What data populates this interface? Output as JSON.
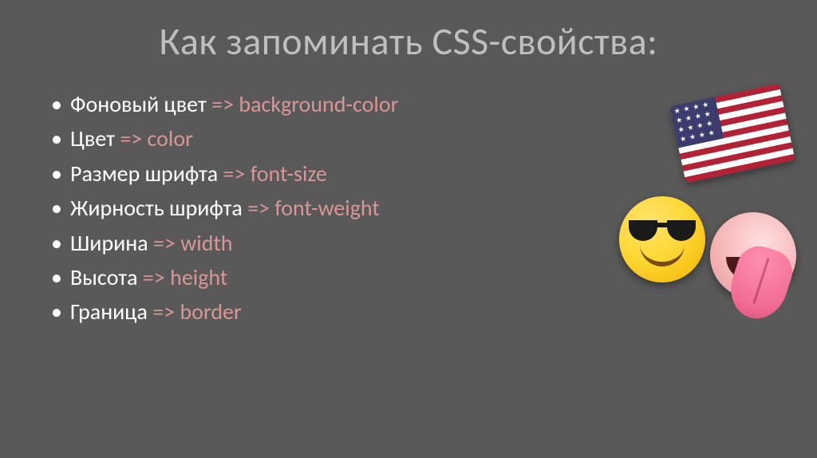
{
  "title": "Как запоминать CSS-свойства:",
  "arrow": "=>",
  "items": [
    {
      "ru": "Фоновый цвет",
      "prop": "background-color"
    },
    {
      "ru": "Цвет",
      "prop": "color"
    },
    {
      "ru": "Размер шрифта",
      "prop": "font-size"
    },
    {
      "ru": "Жирность шрифта",
      "prop": "font-weight"
    },
    {
      "ru": "Ширина",
      "prop": "width"
    },
    {
      "ru": "Высота",
      "prop": "height"
    },
    {
      "ru": "Граница",
      "prop": "border"
    }
  ],
  "colors": {
    "background": "#595959",
    "title": "#bfbfbf",
    "text": "#ffffff",
    "accent": "#d99694"
  },
  "decor": {
    "flag": "us-flag",
    "smiley": "sunglasses-smiley",
    "tongue": "tongue-face"
  }
}
